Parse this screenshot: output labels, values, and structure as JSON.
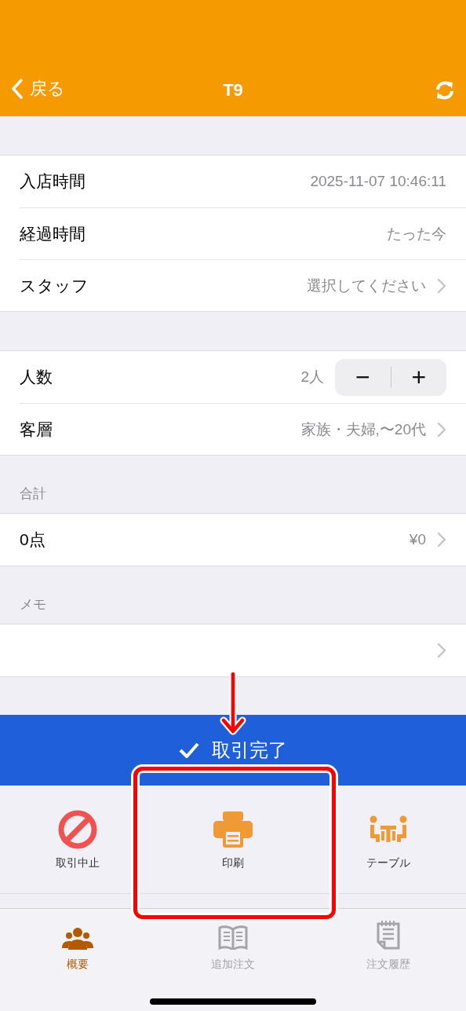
{
  "header": {
    "back_label": "戻る",
    "title": "T9"
  },
  "groups": [
    {
      "rows": [
        {
          "kind": "value",
          "label": "入店時間",
          "value": "2025-11-07 10:46:11"
        },
        {
          "kind": "value",
          "label": "経過時間",
          "value": "たった今"
        },
        {
          "kind": "disclosure",
          "label": "スタッフ",
          "value": "選択してください"
        }
      ]
    },
    {
      "rows": [
        {
          "kind": "stepper",
          "label": "人数",
          "value": "2人",
          "minus": "−",
          "plus": "+"
        },
        {
          "kind": "disclosure",
          "label": "客層",
          "value": "家族・夫婦,〜20代"
        }
      ]
    },
    {
      "heading": "合計",
      "rows": [
        {
          "kind": "disclosure",
          "label": "0点",
          "value": "¥0"
        }
      ]
    },
    {
      "heading": "メモ",
      "rows": [
        {
          "kind": "disclosure"
        }
      ]
    }
  ],
  "complete_button": "取引完了",
  "actions": [
    {
      "kind": "cancel",
      "label": "取引中止"
    },
    {
      "kind": "print",
      "label": "印刷"
    },
    {
      "kind": "table",
      "label": "テーブル"
    }
  ],
  "tabs": [
    {
      "kind": "overview",
      "label": "概要",
      "selected": true
    },
    {
      "kind": "add",
      "label": "追加注文",
      "selected": false
    },
    {
      "kind": "history",
      "label": "注文履歴",
      "selected": false
    }
  ]
}
